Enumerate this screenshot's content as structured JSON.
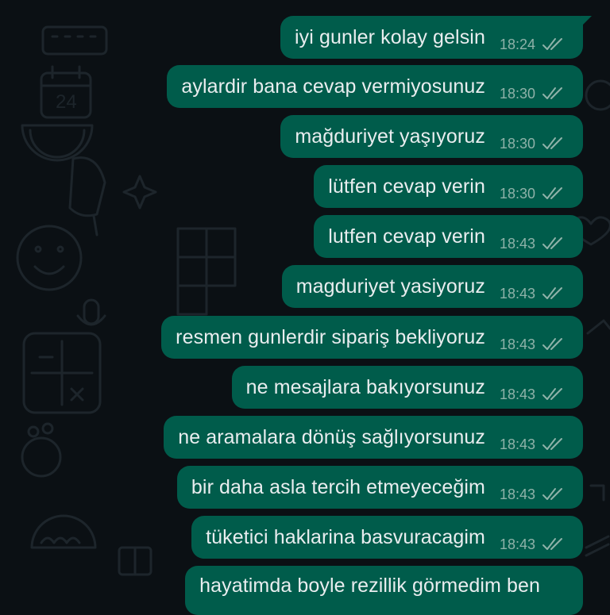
{
  "colors": {
    "background": "#0b1014",
    "doodle": "#1d252b",
    "bubble": "#005c4b",
    "text": "#e9edef",
    "meta": "#8fb2a9"
  },
  "messages": [
    {
      "text": "iyi gunler kolay gelsin",
      "time": "18:24",
      "status": "double-check-icon"
    },
    {
      "text": "aylardir bana cevap vermiyosunuz",
      "time": "18:30",
      "status": "double-check-icon"
    },
    {
      "text": "mağduriyet yaşıyoruz",
      "time": "18:30",
      "status": "double-check-icon"
    },
    {
      "text": "lütfen cevap verin",
      "time": "18:30",
      "status": "double-check-icon"
    },
    {
      "text": "lutfen cevap verin",
      "time": "18:43",
      "status": "double-check-icon"
    },
    {
      "text": "magduriyet yasiyoruz",
      "time": "18:43",
      "status": "double-check-icon"
    },
    {
      "text": "resmen gunlerdir sipariş bekliyoruz",
      "time": "18:43",
      "status": "double-check-icon"
    },
    {
      "text": "ne mesajlara bakıyorsunuz",
      "time": "18:43",
      "status": "double-check-icon"
    },
    {
      "text": "ne aramalara dönüş sağlıyorsunuz",
      "time": "18:43",
      "status": "double-check-icon"
    },
    {
      "text": "bir daha asla tercih etmeyeceğim",
      "time": "18:43",
      "status": "double-check-icon"
    },
    {
      "text": "tüketici haklarina basvuracagim",
      "time": "18:43",
      "status": "double-check-icon"
    },
    {
      "text": "hayatimda boyle rezillik görmedim ben",
      "time": "",
      "status": ""
    }
  ]
}
